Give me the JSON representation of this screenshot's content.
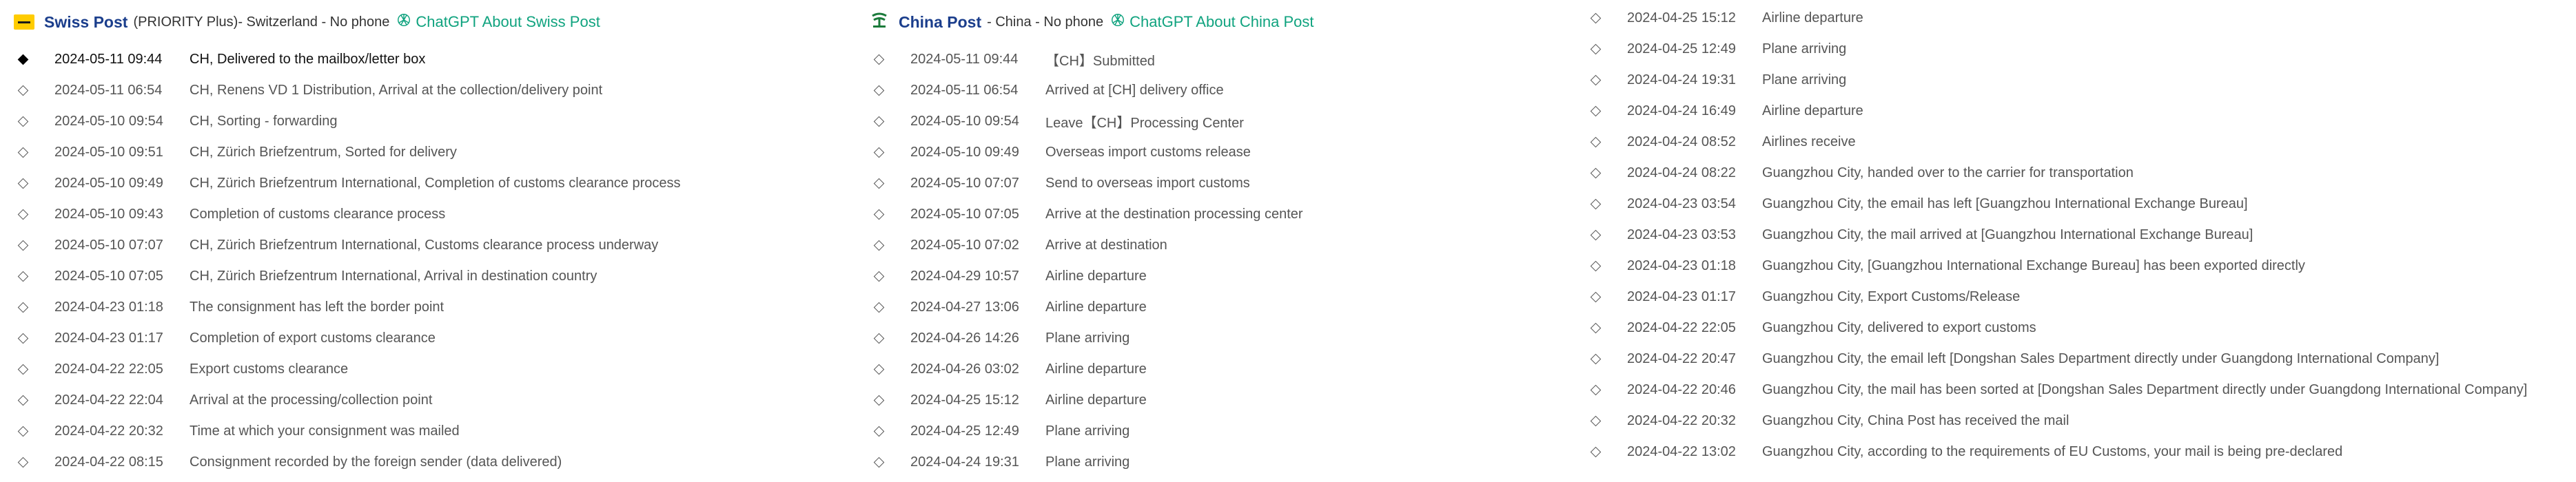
{
  "swiss": {
    "name": "Swiss Post",
    "plan": "(PRIORITY Plus)",
    "meta": " - Switzerland - No phone",
    "gpt_link": "ChatGPT About Swiss Post",
    "events": [
      {
        "time": "2024-05-11 09:44",
        "desc": "CH, Delivered to the mailbox/letter box"
      },
      {
        "time": "2024-05-11 06:54",
        "desc": "CH, Renens VD 1 Distribution, Arrival at the collection/delivery point"
      },
      {
        "time": "2024-05-10 09:54",
        "desc": "CH, Sorting - forwarding"
      },
      {
        "time": "2024-05-10 09:51",
        "desc": "CH, Zürich Briefzentrum, Sorted for delivery"
      },
      {
        "time": "2024-05-10 09:49",
        "desc": "CH, Zürich Briefzentrum International, Completion of customs clearance process"
      },
      {
        "time": "2024-05-10 09:43",
        "desc": "Completion of customs clearance process"
      },
      {
        "time": "2024-05-10 07:07",
        "desc": "CH, Zürich Briefzentrum International, Customs clearance process underway"
      },
      {
        "time": "2024-05-10 07:05",
        "desc": "CH, Zürich Briefzentrum International, Arrival in destination country"
      },
      {
        "time": "2024-04-23 01:18",
        "desc": "The consignment has left the border point"
      },
      {
        "time": "2024-04-23 01:17",
        "desc": "Completion of export customs clearance"
      },
      {
        "time": "2024-04-22 22:05",
        "desc": "Export customs clearance"
      },
      {
        "time": "2024-04-22 22:04",
        "desc": "Arrival at the processing/collection point"
      },
      {
        "time": "2024-04-22 20:32",
        "desc": "Time at which your consignment was mailed"
      },
      {
        "time": "2024-04-22 08:15",
        "desc": "Consignment recorded by the foreign sender (data delivered)"
      }
    ]
  },
  "china": {
    "name": "China Post",
    "meta": " - China - No phone",
    "gpt_link": "ChatGPT About China Post",
    "events": [
      {
        "time": "2024-05-11 09:44",
        "desc": "【CH】Submitted"
      },
      {
        "time": "2024-05-11 06:54",
        "desc": "Arrived at [CH] delivery office"
      },
      {
        "time": "2024-05-10 09:54",
        "desc": "Leave【CH】Processing Center"
      },
      {
        "time": "2024-05-10 09:49",
        "desc": "Overseas import customs release"
      },
      {
        "time": "2024-05-10 07:07",
        "desc": "Send to overseas import customs"
      },
      {
        "time": "2024-05-10 07:05",
        "desc": "Arrive at the destination processing center"
      },
      {
        "time": "2024-05-10 07:02",
        "desc": "Arrive at destination"
      },
      {
        "time": "2024-04-29 10:57",
        "desc": "Airline departure"
      },
      {
        "time": "2024-04-27 13:06",
        "desc": "Airline departure"
      },
      {
        "time": "2024-04-26 14:26",
        "desc": "Plane arriving"
      },
      {
        "time": "2024-04-26 03:02",
        "desc": "Airline departure"
      },
      {
        "time": "2024-04-25 15:12",
        "desc": "Airline departure"
      },
      {
        "time": "2024-04-25 12:49",
        "desc": "Plane arriving"
      },
      {
        "time": "2024-04-24 19:31",
        "desc": "Plane arriving"
      }
    ]
  },
  "continued": {
    "events": [
      {
        "time": "2024-04-25 15:12",
        "desc": "Airline departure"
      },
      {
        "time": "2024-04-25 12:49",
        "desc": "Plane arriving"
      },
      {
        "time": "2024-04-24 19:31",
        "desc": "Plane arriving"
      },
      {
        "time": "2024-04-24 16:49",
        "desc": "Airline departure"
      },
      {
        "time": "2024-04-24 08:52",
        "desc": "Airlines receive"
      },
      {
        "time": "2024-04-24 08:22",
        "desc": "Guangzhou City, handed over to the carrier for transportation"
      },
      {
        "time": "2024-04-23 03:54",
        "desc": "Guangzhou City, the email has left [Guangzhou International Exchange Bureau]"
      },
      {
        "time": "2024-04-23 03:53",
        "desc": "Guangzhou City, the mail arrived at [Guangzhou International Exchange Bureau]"
      },
      {
        "time": "2024-04-23 01:18",
        "desc": "Guangzhou City, [Guangzhou International Exchange Bureau] has been exported directly"
      },
      {
        "time": "2024-04-23 01:17",
        "desc": "Guangzhou City, Export Customs/Release"
      },
      {
        "time": "2024-04-22 22:05",
        "desc": "Guangzhou City, delivered to export customs"
      },
      {
        "time": "2024-04-22 20:47",
        "desc": "Guangzhou City, the email left [Dongshan Sales Department directly under Guangdong International Company]"
      },
      {
        "time": "2024-04-22 20:46",
        "desc": "Guangzhou City, the mail has been sorted at [Dongshan Sales Department directly under Guangdong International Company]"
      },
      {
        "time": "2024-04-22 20:32",
        "desc": "Guangzhou City, China Post has received the mail"
      },
      {
        "time": "2024-04-22 13:02",
        "desc": "Guangzhou City, according to the requirements of EU Customs, your mail is being pre-declared"
      }
    ]
  }
}
